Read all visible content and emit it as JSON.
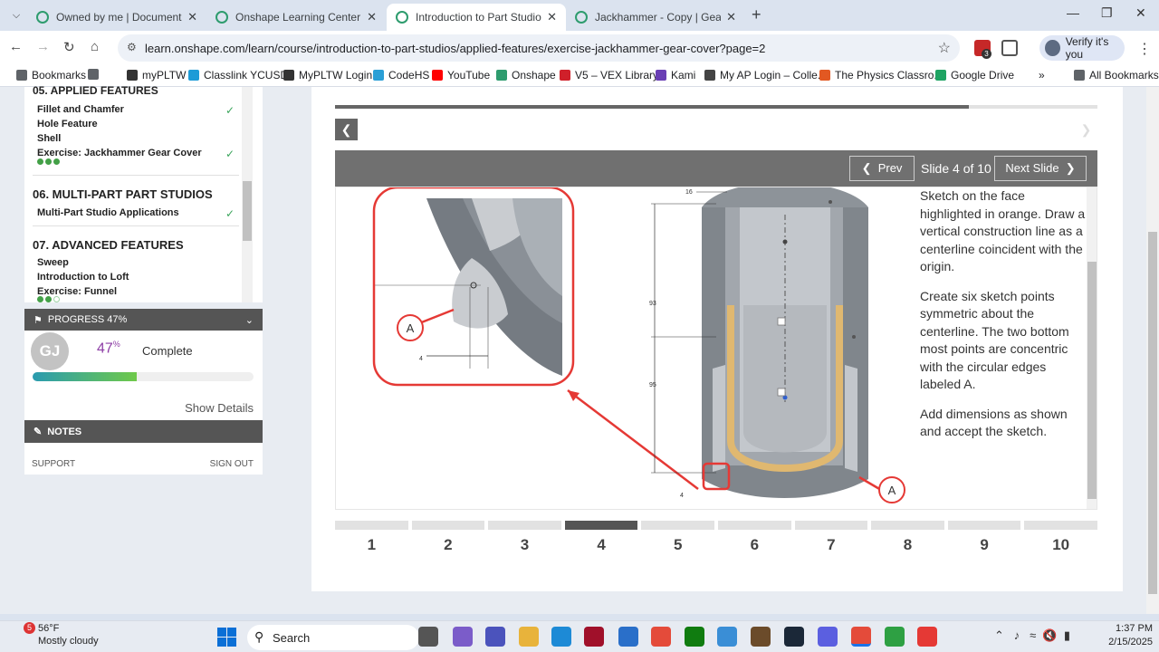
{
  "tabs": [
    {
      "title": "Owned by me | Documents",
      "active": false
    },
    {
      "title": "Onshape Learning Center",
      "active": false
    },
    {
      "title": "Introduction to Part Studios - E",
      "active": true
    },
    {
      "title": "Jackhammer - Copy | Gear Cov",
      "active": false
    }
  ],
  "toolbar": {
    "url": "learn.onshape.com/learn/course/introduction-to-part-studios/applied-features/exercise-jackhammer-gear-cover?page=2",
    "verify_label": "Verify it's you",
    "ext_badge": "3"
  },
  "bookmarks": [
    {
      "label": "Bookmarks",
      "color": "#5f6368"
    },
    {
      "label": "",
      "color": "#5f6368"
    },
    {
      "label": "myPLTW",
      "color": "#333"
    },
    {
      "label": "Classlink YCUSD",
      "color": "#1d9bd7"
    },
    {
      "label": "MyPLTW Login",
      "color": "#333"
    },
    {
      "label": "CodeHS",
      "color": "#2a9fd6"
    },
    {
      "label": "YouTube",
      "color": "#ff0000"
    },
    {
      "label": "Onshape",
      "color": "#2e9c6e"
    },
    {
      "label": "V5 – VEX Library",
      "color": "#d0202a"
    },
    {
      "label": "Kami",
      "color": "#6a3fb5"
    },
    {
      "label": "My AP Login – Colle...",
      "color": "#444"
    },
    {
      "label": "The Physics Classro...",
      "color": "#e25822"
    },
    {
      "label": "Google Drive",
      "color": "#1fa463"
    },
    {
      "label": "All Bookmarks",
      "color": "#5f6368"
    }
  ],
  "sidebar": {
    "cut_section": "05. APPLIED FEATURES",
    "items_top": [
      {
        "label": "Fillet and Chamfer",
        "checked": true
      },
      {
        "label": "Hole Feature",
        "checked": false
      },
      {
        "label": "Shell",
        "checked": false
      },
      {
        "label": "Exercise: Jackhammer Gear Cover",
        "checked": true
      }
    ],
    "section_06": "06. MULTI-PART PART STUDIOS",
    "item_06": "Multi-Part Studio Applications",
    "section_07": "07. ADVANCED FEATURES",
    "items_07": [
      "Sweep",
      "Introduction to Loft",
      "Exercise: Funnel"
    ]
  },
  "progress": {
    "header": "PROGRESS 47%",
    "initials": "GJ",
    "percent": "47",
    "percent_sign": "%",
    "percent_value": 0.47,
    "complete_label": "Complete",
    "show_details": "Show Details"
  },
  "notes": {
    "header": "NOTES",
    "support": "SUPPORT",
    "signout": "SIGN OUT"
  },
  "slide": {
    "prev": "Prev",
    "next": "Next Slide",
    "counter": "Slide 4 of 10",
    "current": 4,
    "pages": [
      "1",
      "2",
      "3",
      "4",
      "5",
      "6",
      "7",
      "8",
      "9",
      "10"
    ],
    "paragraphs": [
      "Sketch on the face highlighted in orange. Draw a vertical construction line as a centerline coincident with the origin.",
      "Create six sketch points symmetric about the centerline. The two bottom most points are concentric with the circular edges labeled A.",
      "Add dimensions as shown and accept the sketch."
    ],
    "figure": {
      "callout_label": "A",
      "dim_4": "4",
      "dim_16": "16",
      "dim_93": "93",
      "dim_95": "95"
    }
  },
  "taskbar": {
    "weather_temp": "56°F",
    "weather_desc": "Mostly cloudy",
    "weather_badge": "5",
    "search": "Search",
    "time": "1:37 PM",
    "date": "2/15/2025"
  }
}
